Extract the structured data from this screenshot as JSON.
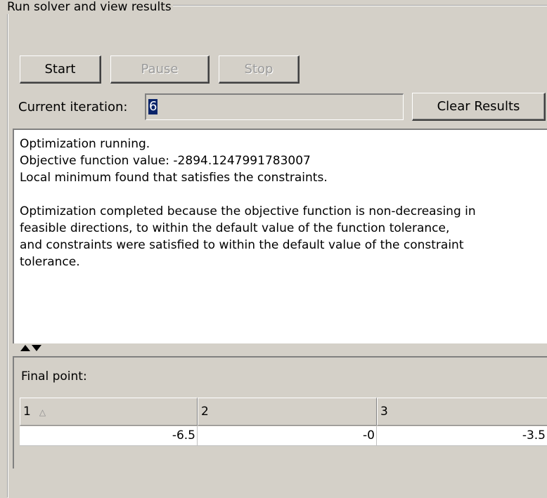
{
  "group": {
    "title": "Run solver and view results"
  },
  "buttons": {
    "start": "Start",
    "pause": "Pause",
    "stop": "Stop",
    "clear_results": "Clear Results"
  },
  "iteration": {
    "label": "Current iteration:",
    "value": "6"
  },
  "output": {
    "lines": [
      "Optimization running.",
      "Objective function value: -2894.1247991783007",
      "Local minimum found that satisfies the constraints.",
      "",
      "Optimization completed because the objective function is non-decreasing in",
      "feasible directions, to within the default value of the function tolerance,",
      "and constraints were satisfied to within the default value of the constraint",
      "tolerance."
    ]
  },
  "final_point": {
    "label": "Final point:",
    "columns": [
      "1",
      "2",
      "3"
    ],
    "values": [
      "-6.5",
      "-0",
      "-3.5"
    ]
  }
}
